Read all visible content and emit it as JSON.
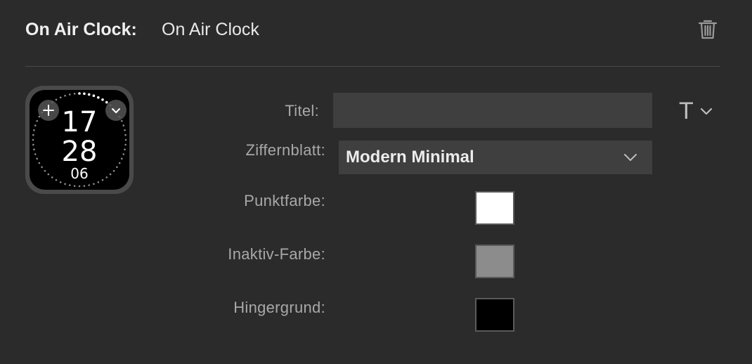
{
  "header": {
    "label": "On Air Clock:",
    "value": "On Air Clock"
  },
  "preview": {
    "hours": "17",
    "minutes": "28",
    "seconds": "06"
  },
  "form": {
    "title_label": "Titel:",
    "title_value": "",
    "text_style_glyph": "T",
    "face_label": "Ziffernblatt:",
    "face_value": "Modern Minimal",
    "dot_color_label": "Punktfarbe:",
    "dot_color": "#ffffff",
    "inactive_color_label": "Inaktiv-Farbe:",
    "inactive_color": "#8c8c8c",
    "background_label": "Hingergrund:",
    "background_color": "#000000"
  },
  "icons": {
    "delete": "trash-icon",
    "add": "plus-icon",
    "dropdown": "chevron-down-icon"
  }
}
